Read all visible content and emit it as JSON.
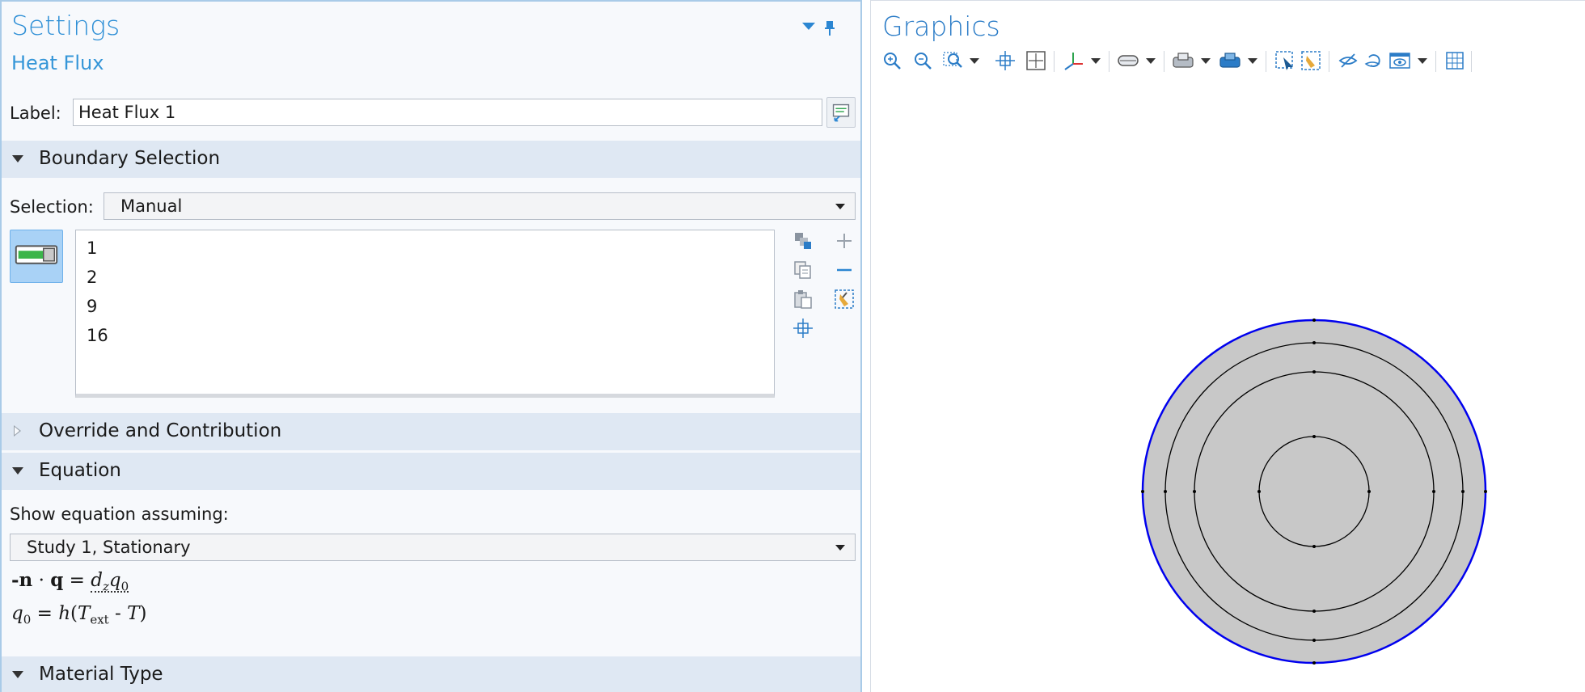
{
  "settings": {
    "title": "Settings",
    "subtitle": "Heat Flux",
    "label_caption": "Label:",
    "label_value": "Heat Flux 1"
  },
  "sections": {
    "boundary_selection": "Boundary Selection",
    "override": "Override and Contribution",
    "equation": "Equation",
    "material_type": "Material Type"
  },
  "selection": {
    "caption": "Selection:",
    "value": "Manual",
    "items": [
      "1",
      "2",
      "9",
      "16"
    ]
  },
  "equation": {
    "show_caption": "Show equation assuming:",
    "study": "Study 1, Stationary"
  },
  "graphics": {
    "title": "Graphics"
  },
  "colors": {
    "accent": "#2e8fd6",
    "section_bg": "#dfe8f3",
    "selected_boundary": "#0000ff",
    "domain_fill": "#c8c8c8"
  },
  "icons": {
    "toolbar": [
      "zoom-in-icon",
      "zoom-out-icon",
      "zoom-box-icon",
      "zoom-extents-icon",
      "zoom-selected-icon",
      "axis-orientation-icon",
      "scene-light-icon",
      "select-box-icon",
      "select-domain-icon",
      "select-object-icon",
      "select-brush-icon",
      "hide-icon",
      "reset-hiding-icon",
      "view-icon",
      "grid-icon"
    ]
  }
}
